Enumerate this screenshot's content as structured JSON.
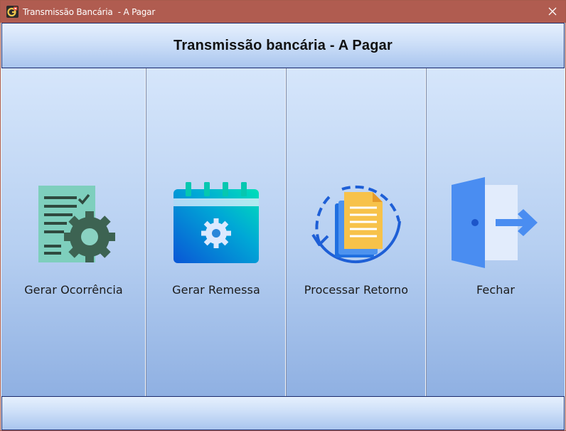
{
  "window": {
    "title": "Transmissão Bancária  - A Pagar",
    "icons": {
      "app": "app-logo-icon",
      "close": "close-icon"
    },
    "titlebar_color": "#b05c50"
  },
  "header": {
    "title": "Transmissão bancária - A Pagar"
  },
  "actions": [
    {
      "label": "Gerar Ocorrência",
      "icon": "document-gear-icon"
    },
    {
      "label": "Gerar Remessa",
      "icon": "calendar-gear-icon"
    },
    {
      "label": "Processar Retorno",
      "icon": "document-refresh-icon"
    },
    {
      "label": "Fechar",
      "icon": "exit-door-icon"
    }
  ],
  "colors": {
    "panel_gradient_top": "#d6e6fb",
    "panel_gradient_bottom": "#8fb0e2",
    "header_border": "#1b2a6b"
  }
}
